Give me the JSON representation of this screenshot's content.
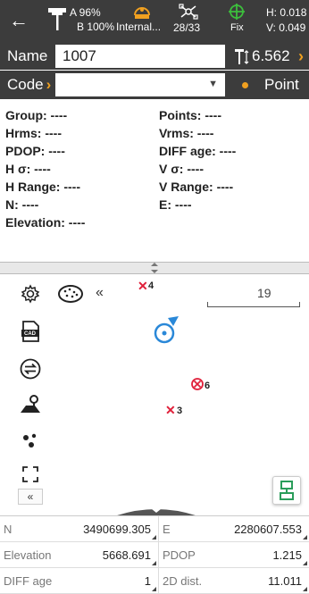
{
  "status": {
    "a_label": "A 96%",
    "b_label": "B 100%",
    "internal_label": "Internal...",
    "satellites": "28/33",
    "fix_label": "Fix",
    "h_value": "H: 0.018",
    "v_value": "V: 0.049"
  },
  "name": {
    "label": "Name",
    "value": "1007",
    "height": "6.562"
  },
  "code": {
    "label": "Code",
    "value": "",
    "point_label": "Point"
  },
  "info": {
    "group": "Group: ----",
    "points": "Points: ----",
    "hrms": "Hrms: ----",
    "vrms": "Vrms: ----",
    "pdop": "PDOP: ----",
    "diff_age": "DIFF age: ----",
    "h_sigma": "H σ: ----",
    "v_sigma": "V σ: ----",
    "h_range": "H Range: ----",
    "v_range": "V Range: ----",
    "n": "N: ----",
    "e": "E: ----",
    "elevation": "Elevation: ----"
  },
  "map": {
    "scale_value": "19",
    "collapse_label": "«",
    "point_4": "4",
    "point_6": "6",
    "point_3": "3",
    "cad_label": "CAD"
  },
  "table": {
    "n_label": "N",
    "n_value": "3490699.305",
    "e_label": "E",
    "e_value": "2280607.553",
    "elev_label": "Elevation",
    "elev_value": "5668.691",
    "pdop_label": "PDOP",
    "pdop_value": "1.215",
    "diff_label": "DIFF age",
    "diff_value": "1",
    "dist_label": "2D dist.",
    "dist_value": "11.011"
  },
  "colors": {
    "accent": "#f0a020",
    "dark": "#3c3c3c",
    "fix": "#3cbf3c",
    "marker_red": "#e0203a",
    "location_blue": "#2a88d8"
  }
}
